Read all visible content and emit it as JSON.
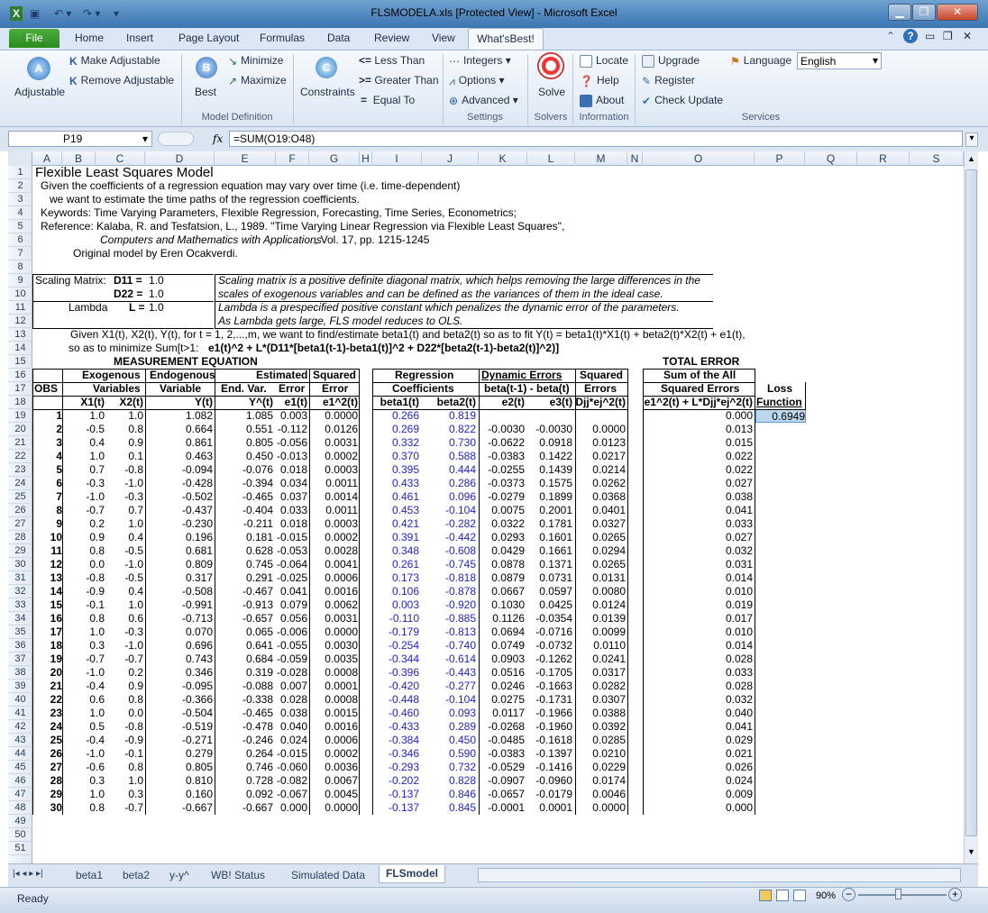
{
  "window": {
    "title": "FLSMODELA.xls  [Protected View]  -  Microsoft Excel"
  },
  "tabs": [
    "File",
    "Home",
    "Insert",
    "Page Layout",
    "Formulas",
    "Data",
    "Review",
    "View",
    "What'sBest!"
  ],
  "ribbon": {
    "adjustable": "Adjustable",
    "make_adjustable": "Make Adjustable",
    "remove_adjustable": "Remove Adjustable",
    "best": "Best",
    "minimize": "Minimize",
    "maximize": "Maximize",
    "constraints": "Constraints",
    "less_than": "Less Than",
    "greater_than": "Greater Than",
    "equal_to": "Equal To",
    "integers": "Integers",
    "options": "Options",
    "advanced": "Advanced",
    "solve": "Solve",
    "locate": "Locate",
    "help": "Help",
    "about": "About",
    "upgrade": "Upgrade",
    "register": "Register",
    "check_update": "Check Update",
    "language_label": "Language",
    "language_value": "English",
    "groups": [
      "Model Definition",
      "Settings",
      "Solvers",
      "Information",
      "Services"
    ],
    "sym_lt": "<=",
    "sym_gt": ">=",
    "sym_eq": "="
  },
  "formula_bar": {
    "cell": "P19",
    "fx": "fx",
    "formula": "=SUM(O19:O48)"
  },
  "columns": [
    "A",
    "B",
    "C",
    "D",
    "E",
    "F",
    "G",
    "H",
    "I",
    "J",
    "K",
    "L",
    "M",
    "N",
    "O",
    "P",
    "Q",
    "R",
    "S"
  ],
  "rows": [
    "1",
    "2",
    "3",
    "4",
    "5",
    "6",
    "7",
    "8",
    "9",
    "10",
    "11",
    "12",
    "13",
    "14",
    "15",
    "16",
    "17",
    "18",
    "19",
    "20",
    "21",
    "22",
    "23",
    "24",
    "25",
    "26",
    "27",
    "28",
    "29",
    "30",
    "31",
    "32",
    "33",
    "34",
    "35",
    "36",
    "37",
    "38",
    "39",
    "40",
    "41",
    "42",
    "43",
    "44",
    "45",
    "46",
    "47",
    "48",
    "49",
    "50",
    "51"
  ],
  "text": {
    "title": "Flexible Least Squares Model",
    "l2": "Given the coefficients of a regression equation may vary over time (i.e. time-dependent)",
    "l3": "we want to estimate the time paths of the regression coefficients.",
    "l4": "Keywords: Time Varying Parameters, Flexible Regression, Forecasting, Time Series, Econometrics;",
    "l5": "Reference: Kalaba, R. and Tesfatsion, L., 1989. \"Time Varying Linear Regression via Flexible Least Squares\",",
    "l6a": "Computers and Mathematics with Applications",
    "l6b": ", Vol. 17, pp. 1215-1245",
    "l7": "Original model by Eren Ocakverdi.",
    "scaling": "Scaling Matrix:",
    "d11": "D11 =",
    "d11v": "1.0",
    "d22": "D22 =",
    "d22v": "1.0",
    "lambda": "Lambda",
    "lv": "L =",
    "lvv": "1.0",
    "sm1": "Scaling matrix is a positive definite diagonal matrix, which helps removing the large differences in the",
    "sm2": "scales of exogenous variables and can be defined as the variances of them in the ideal case.",
    "lm1": "Lambda is a prespecified positive constant which penalizes the dynamic error of the parameters.",
    "lm2": "As Lambda gets large, FLS model reduces to OLS.",
    "l13": "Given X1(t), X2(t), Y(t), for t = 1, 2,...,m,  we want to find/estimate beta1(t) and beta2(t) so as to fit  Y(t) = beta1(t)*X1(t) + beta2(t)*X2(t) + e1(t),",
    "l14a": "so as to minimize  Sum[t>1: ",
    "l14b": "e1(t)^2 + L*(D11*[beta1(t-1)-beta1(t)]^2 + D22*[beta2(t-1)-beta2(t)]^2)]",
    "meas": "MEASUREMENT EQUATION",
    "exo": "Exogenous",
    "endo": "Endogenous",
    "estimated": "Estimated",
    "squared": "Squared",
    "regression": "Regression",
    "dyn": "Dynamic Errors",
    "sq2": "Squared",
    "total": "TOTAL ERROR",
    "obs": "OBS",
    "variables": "Variables",
    "variable": "Variable",
    "endvar": "End. Var.",
    "error": "Error",
    "error2": "Error",
    "coef": "Coefficients",
    "betadiff": "beta(t-1) - beta(t)",
    "errors": "Errors",
    "sumall": "Sum of the All",
    "sqerr": "Squared Errors",
    "loss": "Loss",
    "function": "Function",
    "h_x1": "X1(t)",
    "h_x2": "X2(t)",
    "h_y": "Y(t)",
    "h_yhat": "Y^(t)",
    "h_e1": "e1(t)",
    "h_e1sq": "e1^2(t)",
    "h_b1": "beta1(t)",
    "h_b2": "beta2(t)",
    "h_e2": "e2(t)",
    "h_e3": "e3(t)",
    "h_dj": "Djj*ej^2(t)",
    "h_tot": "e1^2(t) + L*Djj*ej^2(t)",
    "loss_value": "0.6949"
  },
  "table": [
    [
      "1",
      "1.0",
      "1.0",
      "1.082",
      "1.085",
      "0.003",
      "0.0000",
      "0.266",
      "0.819",
      "",
      "",
      "",
      "0.000"
    ],
    [
      "2",
      "-0.5",
      "0.8",
      "0.664",
      "0.551",
      "-0.112",
      "0.0126",
      "0.269",
      "0.822",
      "-0.0030",
      "-0.0030",
      "0.0000",
      "0.013"
    ],
    [
      "3",
      "0.4",
      "0.9",
      "0.861",
      "0.805",
      "-0.056",
      "0.0031",
      "0.332",
      "0.730",
      "-0.0622",
      "0.0918",
      "0.0123",
      "0.015"
    ],
    [
      "4",
      "1.0",
      "0.1",
      "0.463",
      "0.450",
      "-0.013",
      "0.0002",
      "0.370",
      "0.588",
      "-0.0383",
      "0.1422",
      "0.0217",
      "0.022"
    ],
    [
      "5",
      "0.7",
      "-0.8",
      "-0.094",
      "-0.076",
      "0.018",
      "0.0003",
      "0.395",
      "0.444",
      "-0.0255",
      "0.1439",
      "0.0214",
      "0.022"
    ],
    [
      "6",
      "-0.3",
      "-1.0",
      "-0.428",
      "-0.394",
      "0.034",
      "0.0011",
      "0.433",
      "0.286",
      "-0.0373",
      "0.1575",
      "0.0262",
      "0.027"
    ],
    [
      "7",
      "-1.0",
      "-0.3",
      "-0.502",
      "-0.465",
      "0.037",
      "0.0014",
      "0.461",
      "0.096",
      "-0.0279",
      "0.1899",
      "0.0368",
      "0.038"
    ],
    [
      "8",
      "-0.7",
      "0.7",
      "-0.437",
      "-0.404",
      "0.033",
      "0.0011",
      "0.453",
      "-0.104",
      "0.0075",
      "0.2001",
      "0.0401",
      "0.041"
    ],
    [
      "9",
      "0.2",
      "1.0",
      "-0.230",
      "-0.211",
      "0.018",
      "0.0003",
      "0.421",
      "-0.282",
      "0.0322",
      "0.1781",
      "0.0327",
      "0.033"
    ],
    [
      "10",
      "0.9",
      "0.4",
      "0.196",
      "0.181",
      "-0.015",
      "0.0002",
      "0.391",
      "-0.442",
      "0.0293",
      "0.1601",
      "0.0265",
      "0.027"
    ],
    [
      "11",
      "0.8",
      "-0.5",
      "0.681",
      "0.628",
      "-0.053",
      "0.0028",
      "0.348",
      "-0.608",
      "0.0429",
      "0.1661",
      "0.0294",
      "0.032"
    ],
    [
      "12",
      "0.0",
      "-1.0",
      "0.809",
      "0.745",
      "-0.064",
      "0.0041",
      "0.261",
      "-0.745",
      "0.0878",
      "0.1371",
      "0.0265",
      "0.031"
    ],
    [
      "13",
      "-0.8",
      "-0.5",
      "0.317",
      "0.291",
      "-0.025",
      "0.0006",
      "0.173",
      "-0.818",
      "0.0879",
      "0.0731",
      "0.0131",
      "0.014"
    ],
    [
      "14",
      "-0.9",
      "0.4",
      "-0.508",
      "-0.467",
      "0.041",
      "0.0016",
      "0.106",
      "-0.878",
      "0.0667",
      "0.0597",
      "0.0080",
      "0.010"
    ],
    [
      "15",
      "-0.1",
      "1.0",
      "-0.991",
      "-0.913",
      "0.079",
      "0.0062",
      "0.003",
      "-0.920",
      "0.1030",
      "0.0425",
      "0.0124",
      "0.019"
    ],
    [
      "16",
      "0.8",
      "0.6",
      "-0.713",
      "-0.657",
      "0.056",
      "0.0031",
      "-0.110",
      "-0.885",
      "0.1126",
      "-0.0354",
      "0.0139",
      "0.017"
    ],
    [
      "17",
      "1.0",
      "-0.3",
      "0.070",
      "0.065",
      "-0.006",
      "0.0000",
      "-0.179",
      "-0.813",
      "0.0694",
      "-0.0716",
      "0.0099",
      "0.010"
    ],
    [
      "18",
      "0.3",
      "-1.0",
      "0.696",
      "0.641",
      "-0.055",
      "0.0030",
      "-0.254",
      "-0.740",
      "0.0749",
      "-0.0732",
      "0.0110",
      "0.014"
    ],
    [
      "19",
      "-0.7",
      "-0.7",
      "0.743",
      "0.684",
      "-0.059",
      "0.0035",
      "-0.344",
      "-0.614",
      "0.0903",
      "-0.1262",
      "0.0241",
      "0.028"
    ],
    [
      "20",
      "-1.0",
      "0.2",
      "0.346",
      "0.319",
      "-0.028",
      "0.0008",
      "-0.396",
      "-0.443",
      "0.0516",
      "-0.1705",
      "0.0317",
      "0.033"
    ],
    [
      "21",
      "-0.4",
      "0.9",
      "-0.095",
      "-0.088",
      "0.007",
      "0.0001",
      "-0.420",
      "-0.277",
      "0.0246",
      "-0.1663",
      "0.0282",
      "0.028"
    ],
    [
      "22",
      "0.6",
      "0.8",
      "-0.366",
      "-0.338",
      "0.028",
      "0.0008",
      "-0.448",
      "-0.104",
      "0.0275",
      "-0.1731",
      "0.0307",
      "0.032"
    ],
    [
      "23",
      "1.0",
      "0.0",
      "-0.504",
      "-0.465",
      "0.038",
      "0.0015",
      "-0.460",
      "0.093",
      "0.0117",
      "-0.1966",
      "0.0388",
      "0.040"
    ],
    [
      "24",
      "0.5",
      "-0.8",
      "-0.519",
      "-0.478",
      "0.040",
      "0.0016",
      "-0.433",
      "0.289",
      "-0.0268",
      "-0.1960",
      "0.0392",
      "0.041"
    ],
    [
      "25",
      "-0.4",
      "-0.9",
      "-0.271",
      "-0.246",
      "0.024",
      "0.0006",
      "-0.384",
      "0.450",
      "-0.0485",
      "-0.1618",
      "0.0285",
      "0.029"
    ],
    [
      "26",
      "-1.0",
      "-0.1",
      "0.279",
      "0.264",
      "-0.015",
      "0.0002",
      "-0.346",
      "0.590",
      "-0.0383",
      "-0.1397",
      "0.0210",
      "0.021"
    ],
    [
      "27",
      "-0.6",
      "0.8",
      "0.805",
      "0.746",
      "-0.060",
      "0.0036",
      "-0.293",
      "0.732",
      "-0.0529",
      "-0.1416",
      "0.0229",
      "0.026"
    ],
    [
      "28",
      "0.3",
      "1.0",
      "0.810",
      "0.728",
      "-0.082",
      "0.0067",
      "-0.202",
      "0.828",
      "-0.0907",
      "-0.0960",
      "0.0174",
      "0.024"
    ],
    [
      "29",
      "1.0",
      "0.3",
      "0.160",
      "0.092",
      "-0.067",
      "0.0045",
      "-0.137",
      "0.846",
      "-0.0657",
      "-0.0179",
      "0.0046",
      "0.009"
    ],
    [
      "30",
      "0.8",
      "-0.7",
      "-0.667",
      "-0.667",
      "0.000",
      "0.0000",
      "-0.137",
      "0.845",
      "-0.0001",
      "0.0001",
      "0.0000",
      "0.000"
    ]
  ],
  "sheet_tabs": [
    "beta1",
    "beta2",
    "y-y^",
    "WB! Status",
    "Simulated Data",
    "FLSmodel"
  ],
  "status": {
    "ready": "Ready",
    "zoom": "90%"
  }
}
